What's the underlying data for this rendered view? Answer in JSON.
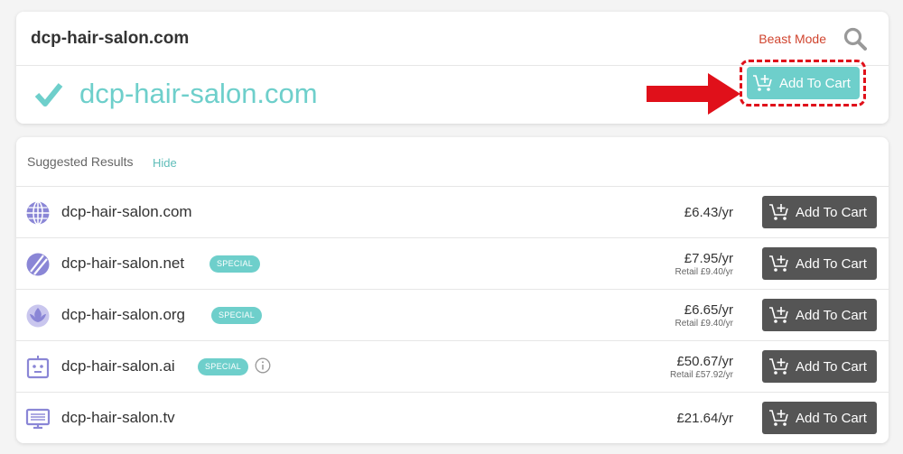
{
  "search": {
    "query": "dcp-hair-salon.com",
    "beast_mode_label": "Beast Mode"
  },
  "hero": {
    "domain": "dcp-hair-salon.com",
    "button_label": "Add To Cart"
  },
  "suggested": {
    "title": "Suggested Results",
    "hide_label": "Hide",
    "rows": [
      {
        "domain": "dcp-hair-salon.com",
        "icon": "globe-icon",
        "badge": "",
        "price": "£6.43/yr",
        "retail": "",
        "button_label": "Add To Cart"
      },
      {
        "domain": "dcp-hair-salon.net",
        "icon": "net-icon",
        "badge": "SPECIAL",
        "price": "£7.95/yr",
        "retail": "Retail £9.40/yr",
        "button_label": "Add To Cart"
      },
      {
        "domain": "dcp-hair-salon.org",
        "icon": "org-icon",
        "badge": "SPECIAL",
        "price": "£6.65/yr",
        "retail": "Retail £9.40/yr",
        "button_label": "Add To Cart"
      },
      {
        "domain": "dcp-hair-salon.ai",
        "icon": "robot-icon",
        "badge": "SPECIAL",
        "price": "£50.67/yr",
        "retail": "Retail £57.92/yr",
        "button_label": "Add To Cart"
      },
      {
        "domain": "dcp-hair-salon.tv",
        "icon": "monitor-icon",
        "badge": "",
        "price": "£21.64/yr",
        "retail": "",
        "button_label": "Add To Cart"
      }
    ]
  },
  "colors": {
    "accent_teal": "#6ecfcb",
    "beast_mode_red": "#d0442e",
    "annotation_red": "#e0101a",
    "icon_purple": "#8a86d6",
    "button_dark": "#555555"
  }
}
